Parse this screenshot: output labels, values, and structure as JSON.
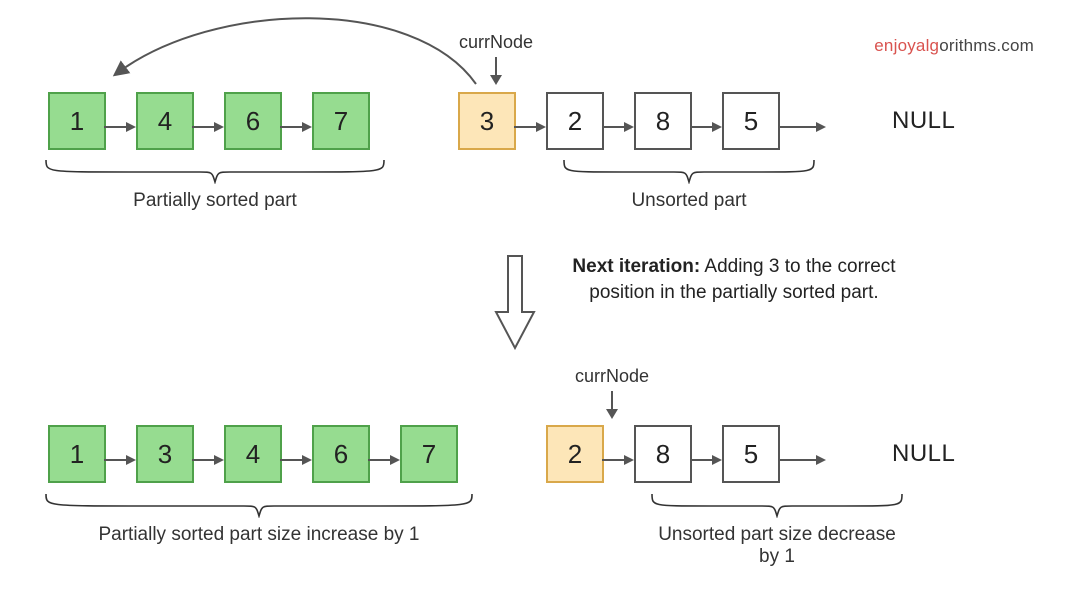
{
  "brand": {
    "accent": "enjoyalg",
    "rest": "orithms.com"
  },
  "stage1": {
    "currNodeLabel": "currNode",
    "nodes": [
      "1",
      "4",
      "6",
      "7",
      "3",
      "2",
      "8",
      "5"
    ],
    "nodeStyles": [
      "sorted",
      "sorted",
      "sorted",
      "sorted",
      "curr",
      "plain",
      "plain",
      "plain"
    ],
    "null": "NULL",
    "braceLeft": "Partially sorted part",
    "braceRight": "Unsorted part"
  },
  "iteration": {
    "bold": "Next iteration:",
    "rest": " Adding 3 to the correct position in the partially sorted part."
  },
  "stage2": {
    "currNodeLabel": "currNode",
    "nodes": [
      "1",
      "3",
      "4",
      "6",
      "7",
      "2",
      "8",
      "5"
    ],
    "nodeStyles": [
      "sorted",
      "sorted",
      "sorted",
      "sorted",
      "sorted",
      "curr",
      "plain",
      "plain"
    ],
    "null": "NULL",
    "braceLeft": "Partially sorted part size increase by 1",
    "braceRight": "Unsorted part size decrease by 1"
  }
}
